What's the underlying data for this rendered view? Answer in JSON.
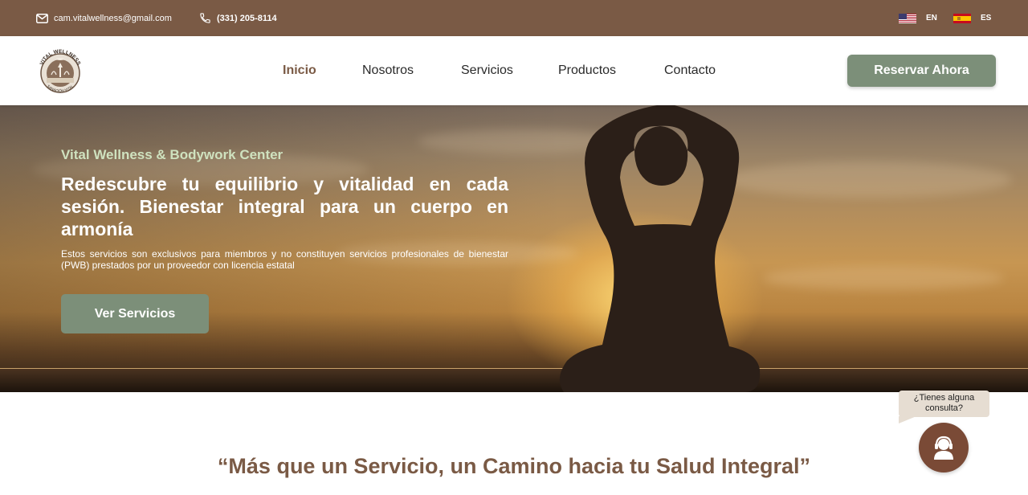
{
  "topbar": {
    "email": "cam.vitalwellness@gmail.com",
    "phone": "(331) 205-8114",
    "languages": [
      {
        "code": "EN",
        "flag": "us-flag-icon"
      },
      {
        "code": "ES",
        "flag": "spain-flag-icon"
      }
    ]
  },
  "header": {
    "logo": {
      "top_text": "VITAL WELLNESS",
      "bottom_text": "SANACIÓN VITAL"
    },
    "nav": [
      {
        "label": "Inicio",
        "active": true
      },
      {
        "label": "Nosotros",
        "active": false
      },
      {
        "label": "Servicios",
        "active": false
      },
      {
        "label": "Productos",
        "active": false
      },
      {
        "label": "Contacto",
        "active": false
      }
    ],
    "cta_label": "Reservar Ahora"
  },
  "hero": {
    "subtitle": "Vital Wellness & Bodywork Center",
    "title": "Redescubre tu equilibrio y vitalidad en cada sesión. Bienestar integral para un cuerpo en armonía",
    "note": "Estos servicios son exclusivos para miembros y no constituyen servicios profesionales de bienestar (PWB) prestados por un proveedor con licencia estatal",
    "button_label": "Ver Servicios"
  },
  "quote": "“Más que un Servicio, un Camino hacia tu Salud Integral”",
  "chat": {
    "bubble_text": "¿Tienes alguna consulta?",
    "icon": "support-agent-icon"
  },
  "colors": {
    "brand_brown": "#7a5a45",
    "sage_green": "#7c8f79",
    "hero_subtitle": "#cfe2bf"
  }
}
